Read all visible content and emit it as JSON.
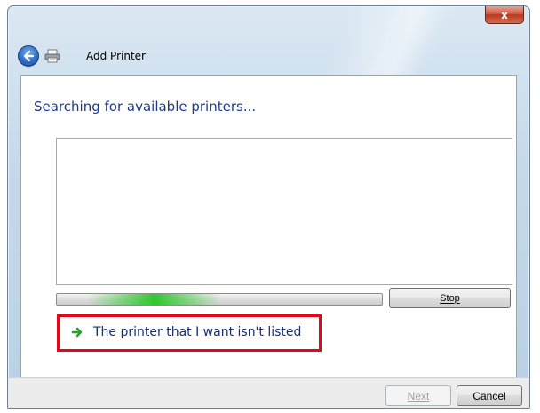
{
  "window": {
    "title": "Add Printer",
    "close_label": "x"
  },
  "icons": {
    "back": "back-arrow-icon",
    "printer": "printer-icon",
    "arrow": "green-arrow-icon",
    "close": "close-icon"
  },
  "main": {
    "heading": "Searching for available printers...",
    "progress_fraction": 0.3,
    "stop_label": "Stop",
    "not_listed_link": "The printer that I want isn't listed"
  },
  "footer": {
    "next_label": "Next",
    "cancel_label": "Cancel",
    "next_enabled": false
  },
  "colors": {
    "accent": "#1e3a8a",
    "highlight_border": "#e3071b",
    "progress_glow": "#2ec82e"
  }
}
